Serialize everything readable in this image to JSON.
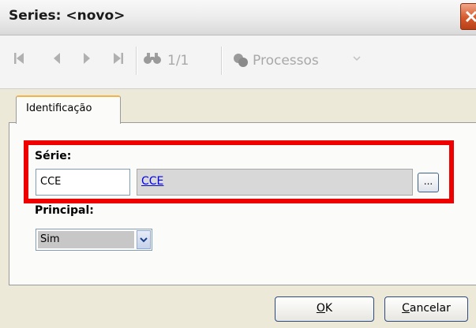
{
  "window": {
    "title": "Series: <novo>"
  },
  "toolbar": {
    "first_icon": "first-record-icon",
    "prev_icon": "previous-record-icon",
    "next_icon": "next-record-icon",
    "last_icon": "last-record-icon",
    "find_icon": "binoculars-icon",
    "record_counter": "1/1",
    "processes_label": "Processos"
  },
  "tabs": [
    {
      "label": "Identificação",
      "active": true
    }
  ],
  "form": {
    "serie": {
      "label": "Série:",
      "code": "CCE",
      "description": "CCE",
      "lookup_button": "..."
    },
    "principal": {
      "label": "Principal:",
      "selected": "Sim"
    }
  },
  "dialog_buttons": {
    "ok": {
      "accel": "O",
      "rest": "K"
    },
    "cancel": {
      "accel": "C",
      "rest": "ancelar"
    }
  },
  "colors": {
    "highlight": "#ee0000",
    "link": "#0000ee",
    "close_button": "#d55a2c"
  }
}
